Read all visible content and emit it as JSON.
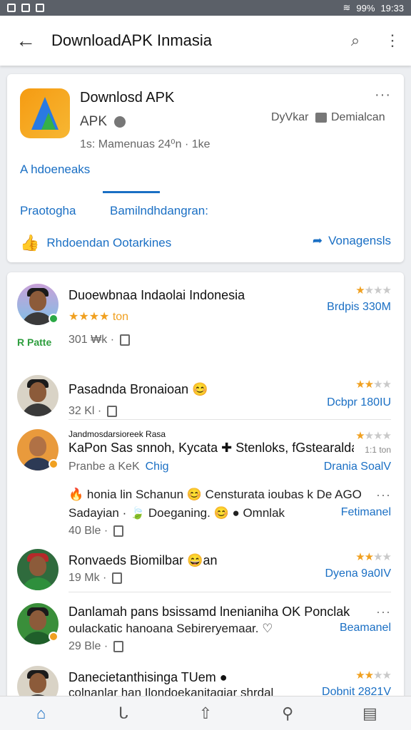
{
  "status": {
    "battery": "99%",
    "time": "19:33"
  },
  "appbar": {
    "back": "←",
    "title": "DownloadAPK Inmasia",
    "search": "⌕",
    "more": "⋮"
  },
  "app": {
    "name": "Downlosd APK",
    "type": "APK",
    "meta": "1s: Mamenuas 24⁰n · 1ke",
    "dev": "DyVkar",
    "dev2": "Demialcan",
    "link": "A hdoeneaks",
    "tab1": "Praotogha",
    "tab2": "Bamilndhdangran:",
    "like": "Rhdoendan Ootarkines",
    "share": "Vonagensls",
    "more": "···"
  },
  "reviews": [
    {
      "name": "Duoewbnaa Indaolai Indonesia",
      "sub": "★★★★ ton",
      "link": "Brdpis 330M",
      "meta": "301 ₩k ·",
      "tag": "R Patte",
      "stars_on": 1,
      "stars_off": 3
    },
    {
      "name": "Pasadnda Bronaioan 😊",
      "link": "Dcbpr 180IU",
      "meta": "32 Kl ·",
      "stars_on": 2,
      "stars_off": 2
    },
    {
      "minihead": "Jandmosdarsioreek          Rasa",
      "name": "KaPon Sas snnoh, Kycata ✚ Stenloks, fGstearalda",
      "sub1": "Pranbe a KeK",
      "sub2": "Chig",
      "link": "Drania SoalV",
      "stars_on": 1,
      "stars_off": 3,
      "extra": "1:1 ton",
      "body1": "🔥 honia lin Schanun 😊 Censturata ioubas k De AGO",
      "body2": "Sadayian · 🍃 Doeganing. 😊 ● Omnlak",
      "body_link": "Fetimanel",
      "meta": "40 Ble ·",
      "more": "···"
    },
    {
      "name": "Ronvaeds Biomilbar 😄an",
      "link": "Dyena 9a0IV",
      "meta": "19 Mk ·",
      "stars_on": 2,
      "stars_off": 2
    },
    {
      "name": "Danlamah pans bsissamd lnenianiha OK Ponclak",
      "body2": "oulackatic hanoana Sebireryemaar. ♡",
      "link": "Beamanel",
      "meta": "29 Ble ·",
      "more": "···"
    },
    {
      "name": "Danecietanthisinga TUem ●",
      "body2": "colnanlar han Ilondoekanitagiar shrdal",
      "link": "Dobnit 2821V",
      "stars_on": 2,
      "stars_off": 2
    }
  ],
  "nav": {
    "home": "⌂",
    "b": "ᒐ",
    "c": "⇧",
    "d": "⚲",
    "e": "▤"
  }
}
